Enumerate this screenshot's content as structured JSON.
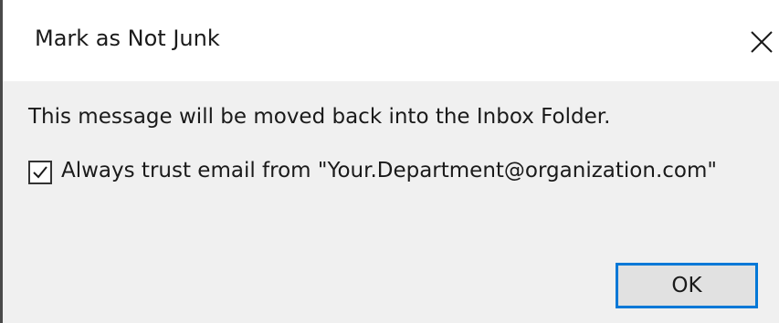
{
  "dialog": {
    "title": "Mark as Not Junk",
    "message": "This message will be moved back into the Inbox Folder.",
    "checkbox": {
      "label": "Always trust email from \"Your.Department@organization.com\"",
      "checked": true
    },
    "ok_label": "OK"
  },
  "icons": {
    "close": "close-icon",
    "check": "check-icon"
  },
  "colors": {
    "focus_border": "#0078d7",
    "dialog_background": "#f0f0f0",
    "title_background": "#ffffff",
    "button_background": "#e1e1e1"
  }
}
